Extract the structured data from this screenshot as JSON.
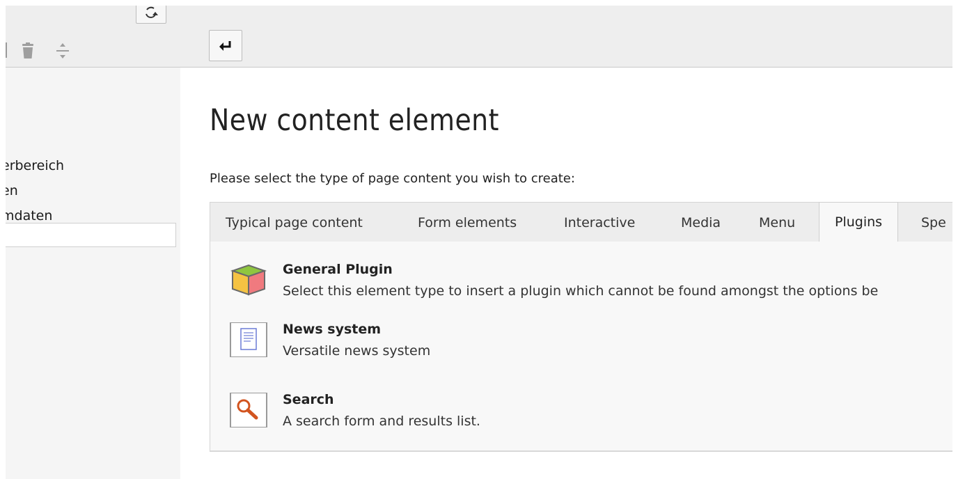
{
  "left_pane": {
    "tree_items": [
      "erbereich",
      "en",
      "mdaten"
    ]
  },
  "right_pane": {
    "page_title": "New content element",
    "instruction": "Please select the type of page content you wish to create:",
    "tabs": [
      {
        "label": "Typical page content"
      },
      {
        "label": "Form elements"
      },
      {
        "label": "Interactive"
      },
      {
        "label": "Media"
      },
      {
        "label": "Menu"
      },
      {
        "label": "Plugins"
      },
      {
        "label": "Spe"
      }
    ],
    "active_tab": "Plugins",
    "elements": [
      {
        "title": "General Plugin",
        "description": "Select this element type to insert a plugin which cannot be found amongst the options be",
        "icon": "cube-icon"
      },
      {
        "title": "News system",
        "description": "Versatile news system",
        "icon": "document-icon"
      },
      {
        "title": "Search",
        "description": "A search form and results list.",
        "icon": "magnifier-icon"
      }
    ]
  },
  "toolbar": {
    "refresh_icon": "refresh-icon",
    "trash_icon": "trash-icon",
    "divide_icon": "divide-icon",
    "back_icon": "return-arrow-icon"
  },
  "colors": {
    "toolbar_bg": "#eeeeee",
    "left_pane_bg": "#f5f5f5",
    "tab_bar_bg": "#ededed",
    "tab_active_bg": "#f8f8f8",
    "search_icon_accent": "#d2541f"
  }
}
